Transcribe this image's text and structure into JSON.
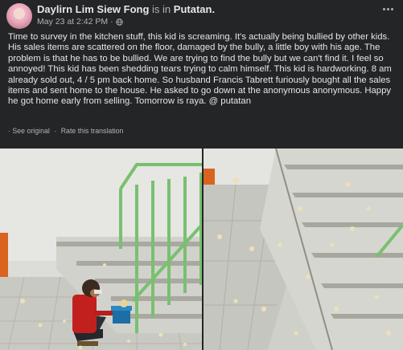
{
  "post": {
    "author": "Daylirn Lim Siew Fong",
    "is_in": "is in",
    "location": "Putatan.",
    "date": "May 23 at 2:42 PM",
    "separator": "·",
    "text": "Time to survey in the kitchen stuff, this kid is screaming. It's actually being bullied by other kids. His sales items are scattered on the floor, damaged by the bully, a little boy with his age. The problem is that he has to be bullied. We are trying to find the bully but we can't find it. I feel so annoyed! This kid has been shedding tears trying to calm himself. This kid is hardworking. 8 am already sold out, 4 / 5 pm back home. So husband Francis Tabrett furiously bought all the sales items and sent home to the house. He asked to go down at the anonymous anonymous. Happy he got home early from selling. Tomorrow is raya. @ putatan",
    "see_original": "See original",
    "rate_translation": "Rate this translation",
    "dot": "·"
  },
  "icons": {
    "avatar": "profile-photo",
    "privacy": "globe-icon",
    "menu": "more-horizontal-icon"
  },
  "photos": [
    {
      "name": "boy-on-stairs-photo"
    },
    {
      "name": "scattered-food-on-stairs-photo"
    }
  ],
  "colors": {
    "background": "#242526",
    "text_primary": "#e4e6eb",
    "text_secondary": "#b0b3b8",
    "railing": "#7cc276",
    "orange": "#e06a22"
  }
}
